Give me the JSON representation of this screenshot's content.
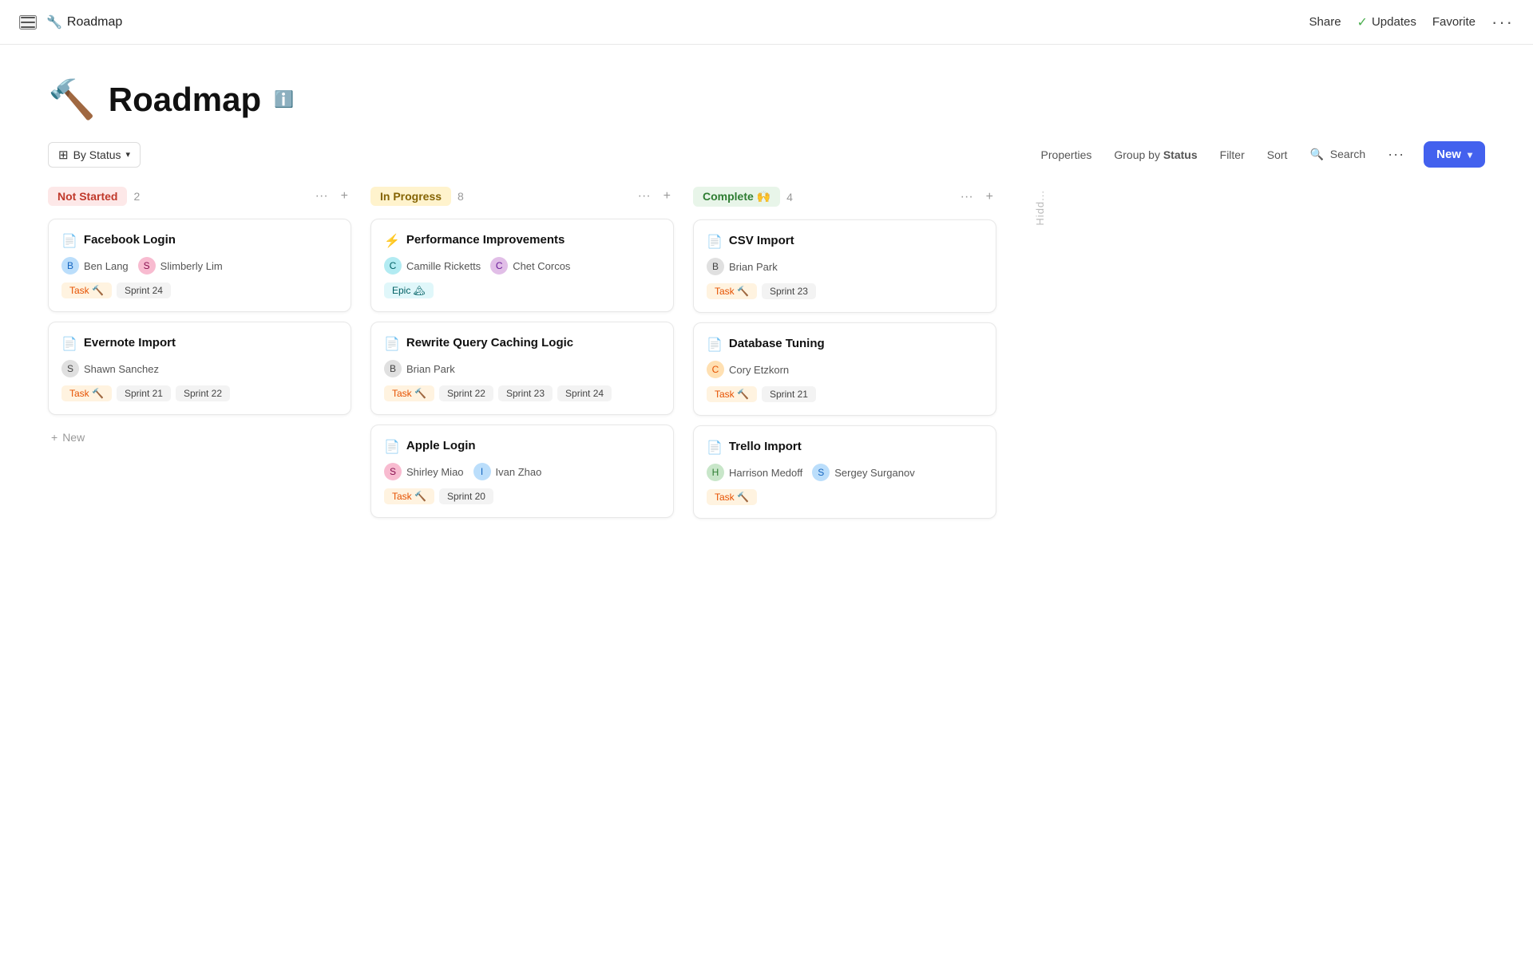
{
  "app": {
    "icon": "🔧",
    "name": "Roadmap",
    "nav": {
      "share": "Share",
      "updates": "Updates",
      "favorite": "Favorite",
      "more": "···"
    }
  },
  "page": {
    "icon": "🔨",
    "title": "Roadmap",
    "info_icon": "ℹ"
  },
  "toolbar": {
    "by_status": "By Status",
    "properties": "Properties",
    "group_by": "Group by",
    "group_by_bold": "Status",
    "filter": "Filter",
    "sort": "Sort",
    "search": "Search",
    "more": "···",
    "new": "New"
  },
  "columns": [
    {
      "id": "not-started",
      "label": "Not Started",
      "type": "not-started",
      "count": "2",
      "cards": [
        {
          "title": "Facebook Login",
          "assignees": [
            {
              "name": "Ben Lang",
              "av_class": "av-blue",
              "initial": "B"
            },
            {
              "name": "Slimberly Lim",
              "av_class": "av-pink",
              "initial": "S"
            }
          ],
          "tags": [
            {
              "label": "Task 🔨",
              "type": "task"
            },
            {
              "label": "Sprint 24",
              "type": "sprint"
            }
          ]
        },
        {
          "title": "Evernote Import",
          "assignees": [
            {
              "name": "Shawn Sanchez",
              "av_class": "av-gray",
              "initial": "S"
            }
          ],
          "tags": [
            {
              "label": "Task 🔨",
              "type": "task"
            },
            {
              "label": "Sprint 21",
              "type": "sprint"
            },
            {
              "label": "Sprint 22",
              "type": "sprint"
            }
          ]
        }
      ]
    },
    {
      "id": "in-progress",
      "label": "In Progress",
      "type": "in-progress",
      "count": "8",
      "cards": [
        {
          "title": "Performance Improvements",
          "assignees": [
            {
              "name": "Camille Ricketts",
              "av_class": "av-teal",
              "initial": "C"
            },
            {
              "name": "Chet Corcos",
              "av_class": "av-purple",
              "initial": "C"
            }
          ],
          "tags": [
            {
              "label": "Epic 🏔",
              "type": "epic"
            }
          ]
        },
        {
          "title": "Rewrite Query Caching Logic",
          "assignees": [
            {
              "name": "Brian Park",
              "av_class": "av-gray",
              "initial": "B"
            }
          ],
          "tags": [
            {
              "label": "Task 🔨",
              "type": "task"
            },
            {
              "label": "Sprint 22",
              "type": "sprint"
            },
            {
              "label": "Sprint 23",
              "type": "sprint"
            },
            {
              "label": "Sprint 24",
              "type": "sprint"
            }
          ]
        },
        {
          "title": "Apple Login",
          "assignees": [
            {
              "name": "Shirley Miao",
              "av_class": "av-pink",
              "initial": "S"
            },
            {
              "name": "Ivan Zhao",
              "av_class": "av-blue",
              "initial": "I"
            }
          ],
          "tags": [
            {
              "label": "Task 🔨",
              "type": "task"
            },
            {
              "label": "Sprint 20",
              "type": "sprint"
            }
          ]
        }
      ]
    },
    {
      "id": "complete",
      "label": "Complete 🙌",
      "type": "complete",
      "count": "4",
      "cards": [
        {
          "title": "CSV Import",
          "assignees": [
            {
              "name": "Brian Park",
              "av_class": "av-gray",
              "initial": "B"
            }
          ],
          "tags": [
            {
              "label": "Task 🔨",
              "type": "task"
            },
            {
              "label": "Sprint 23",
              "type": "sprint"
            }
          ]
        },
        {
          "title": "Database Tuning",
          "assignees": [
            {
              "name": "Cory Etzkorn",
              "av_class": "av-orange",
              "initial": "C"
            }
          ],
          "tags": [
            {
              "label": "Task 🔨",
              "type": "task"
            },
            {
              "label": "Sprint 21",
              "type": "sprint"
            }
          ]
        },
        {
          "title": "Trello Import",
          "assignees": [
            {
              "name": "Harrison Medoff",
              "av_class": "av-green",
              "initial": "H"
            },
            {
              "name": "Sergey Surganov",
              "av_class": "av-blue",
              "initial": "S"
            }
          ],
          "tags": [
            {
              "label": "Task 🔨",
              "type": "task"
            }
          ]
        }
      ]
    }
  ],
  "add_new_label": "+ New",
  "hidden_label": "Hidd..."
}
